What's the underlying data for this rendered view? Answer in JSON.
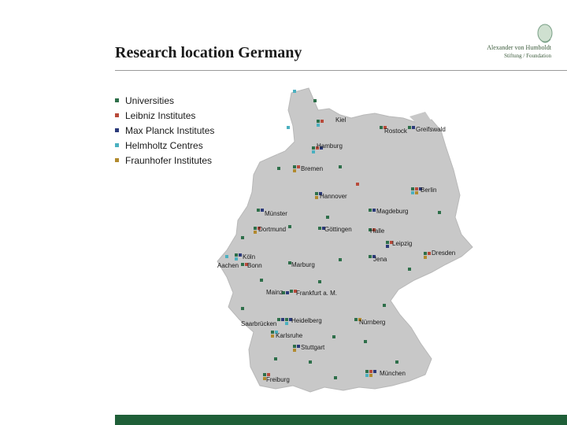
{
  "title": "Research location Germany",
  "logo": {
    "name": "Alexander von Humboldt",
    "sub": "Stiftung / Foundation",
    "icon": "humboldt-portrait-icon"
  },
  "legend": [
    {
      "label": "Universities",
      "color": "#2e6f4a"
    },
    {
      "label": "Leibniz Institutes",
      "color": "#b84a3a"
    },
    {
      "label": "Max Planck Institutes",
      "color": "#2b3a7a"
    },
    {
      "label": "Helmholtz Centres",
      "color": "#4bb0c0"
    },
    {
      "label": "Fraunhofer Institutes",
      "color": "#b28a2e"
    }
  ],
  "cities": {
    "kiel": "Kiel",
    "rostock": "Rostock",
    "greifswald": "Greifswald",
    "hamburg": "Hamburg",
    "bremen": "Bremen",
    "berlin": "Berlin",
    "hannover": "Hannover",
    "magdeburg": "Magdeburg",
    "muenster": "Münster",
    "dortmund": "Dortmund",
    "goettingen": "Göttingen",
    "halle": "Halle",
    "leipzig": "Leipzig",
    "dresden": "Dresden",
    "koeln": "Köln",
    "aachen": "Aachen",
    "bonn": "Bonn",
    "jena": "Jena",
    "marburg": "Marburg",
    "mainz": "Mainz",
    "frankfurt": "Frankfurt a. M.",
    "saarbruecken": "Saarbrücken",
    "heidelberg": "Heidelberg",
    "nuernberg": "Nürnberg",
    "karlsruhe": "Karlsruhe",
    "stuttgart": "Stuttgart",
    "muenchen": "München",
    "freiburg": "Freiburg"
  }
}
